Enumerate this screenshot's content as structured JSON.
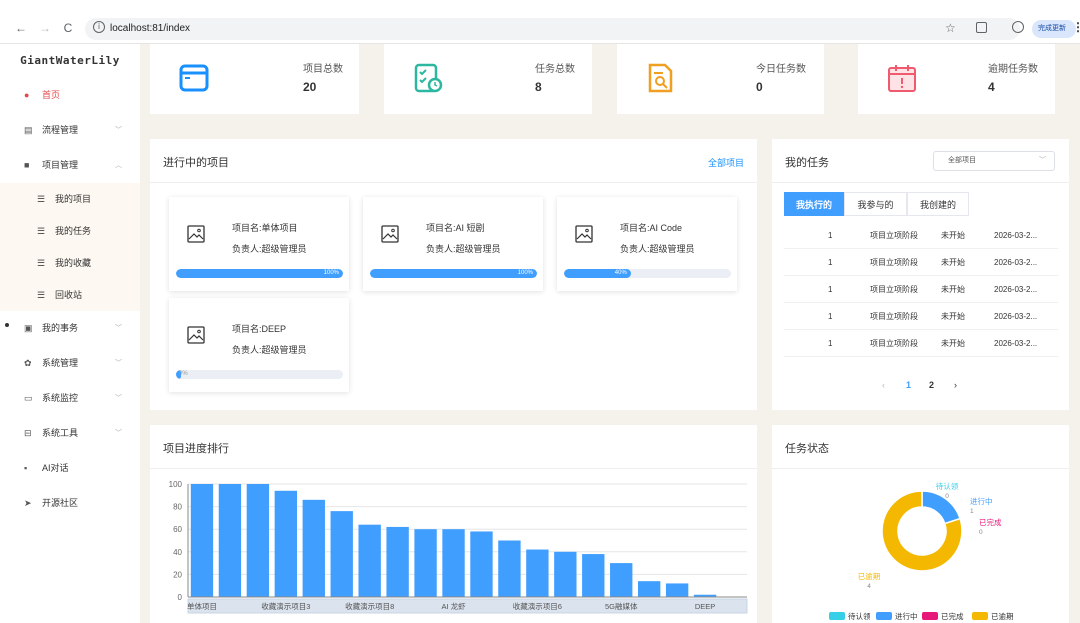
{
  "browser": {
    "url": "localhost:81/index",
    "update_label": "完成更新",
    "back": "←",
    "forward": "→",
    "reload": "C"
  },
  "sidebar": {
    "brand": "GiantWaterLily",
    "items": [
      {
        "label": "首页",
        "icon": "dashboard-icon",
        "active": true
      },
      {
        "label": "流程管理",
        "icon": "document-icon",
        "expanded": false
      },
      {
        "label": "项目管理",
        "icon": "folder-icon",
        "expanded": true
      },
      {
        "label": "我的事务",
        "icon": "clipboard-icon",
        "expanded": false
      },
      {
        "label": "系统管理",
        "icon": "gear-icon",
        "expanded": false
      },
      {
        "label": "系统监控",
        "icon": "monitor-icon",
        "expanded": false
      },
      {
        "label": "系统工具",
        "icon": "toolbox-icon",
        "expanded": false
      },
      {
        "label": "AI对话",
        "icon": "chat-icon"
      },
      {
        "label": "开源社区",
        "icon": "send-icon"
      }
    ],
    "project_submenu": [
      "我的项目",
      "我的任务",
      "我的收藏",
      "回收站"
    ]
  },
  "stats": [
    {
      "label": "项目总数",
      "value": "20",
      "icon": "window-icon",
      "color": "#1890ff"
    },
    {
      "label": "任务总数",
      "value": "8",
      "icon": "task-clock-icon",
      "color": "#2db7a0"
    },
    {
      "label": "今日任务数",
      "value": "0",
      "icon": "doc-search-icon",
      "color": "#f0a020"
    },
    {
      "label": "逾期任务数",
      "value": "4",
      "icon": "calendar-alert-icon",
      "color": "#f05a6e"
    }
  ],
  "projects_panel": {
    "title": "进行中的项目",
    "link": "全部项目",
    "projects": [
      {
        "name": "项目名:单体项目",
        "owner": "负责人:超级管理员",
        "progress": 100,
        "progress_label": "100%"
      },
      {
        "name": "项目名:AI 短剧",
        "owner": "负责人:超级管理员",
        "progress": 100,
        "progress_label": "100%"
      },
      {
        "name": "项目名:AI Code",
        "owner": "负责人:超级管理员",
        "progress": 40,
        "progress_label": "40%"
      },
      {
        "name": "项目名:DEEP",
        "owner": "负责人:超级管理员",
        "progress": 0,
        "progress_label": "0%"
      }
    ]
  },
  "tasks_panel": {
    "title": "我的任务",
    "filter": "全部项目",
    "tabs": [
      "我执行的",
      "我参与的",
      "我创建的"
    ],
    "active_tab": 0,
    "rows": [
      {
        "id": "1",
        "stage": "项目立项阶段",
        "status": "未开始",
        "date": "2026-03-2..."
      },
      {
        "id": "1",
        "stage": "项目立项阶段",
        "status": "未开始",
        "date": "2026-03-2..."
      },
      {
        "id": "1",
        "stage": "项目立项阶段",
        "status": "未开始",
        "date": "2026-03-2..."
      },
      {
        "id": "1",
        "stage": "项目立项阶段",
        "status": "未开始",
        "date": "2026-03-2..."
      },
      {
        "id": "1",
        "stage": "项目立项阶段",
        "status": "未开始",
        "date": "2026-03-2..."
      }
    ],
    "pager": {
      "prev": "‹",
      "pages": [
        "1",
        "2"
      ],
      "current": "1",
      "next": "›"
    }
  },
  "chart_data": [
    {
      "type": "bar",
      "title": "项目进度排行",
      "x_tick_labels": [
        "单体项目",
        "收藏演示项目3",
        "收藏演示项目8",
        "AI 龙虾",
        "收藏演示项目6",
        "5G融媒体",
        "DEEP"
      ],
      "values": [
        100,
        100,
        100,
        94,
        86,
        76,
        64,
        62,
        60,
        60,
        58,
        50,
        42,
        40,
        38,
        30,
        14,
        12,
        2,
        0
      ],
      "ylim": [
        0,
        100
      ],
      "yticks": [
        0,
        20,
        40,
        60,
        80,
        100
      ],
      "color": "#409eff",
      "grid": true
    },
    {
      "type": "pie",
      "title": "任务状态",
      "donut": true,
      "slices": [
        {
          "name": "待认领",
          "value": 0,
          "color": "#36cfe8"
        },
        {
          "name": "进行中",
          "value": 1,
          "color": "#409eff"
        },
        {
          "name": "已完成",
          "value": 0,
          "color": "#e6197a"
        },
        {
          "name": "已逾期",
          "value": 4,
          "color": "#f5b800"
        }
      ],
      "legend_placement": "bottom"
    }
  ]
}
